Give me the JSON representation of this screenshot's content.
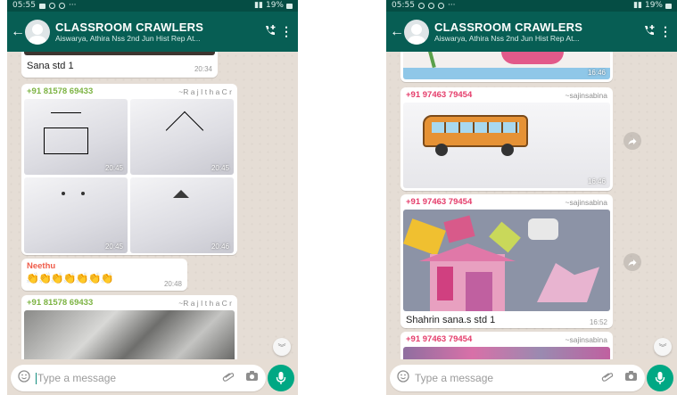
{
  "left": {
    "status": {
      "time": "05:55",
      "dots": "···",
      "battery": "19%"
    },
    "header": {
      "title": "CLASSROOM CRAWLERS",
      "subtitle": "Aiswarya, Athira Nss 2nd Jun Hist Rep At..."
    },
    "messages": {
      "top_text": "Sana std 1",
      "top_time": "20:34",
      "group1_sender": "+91 81578 69433",
      "group1_alias": "~R a j I t h a  C r",
      "img_times": [
        "20:45",
        "20:45",
        "20:45",
        "20:46"
      ],
      "neethu_sender": "Neethu",
      "claps": "👏👏👏👏👏👏👏",
      "claps_time": "20:48",
      "group2_sender": "+91 81578 69433",
      "group2_alias": "~R a j I t h a  C r"
    },
    "composer": {
      "placeholder": "Type a message"
    }
  },
  "right": {
    "status": {
      "time": "05:55",
      "dots": "···",
      "battery": "19%"
    },
    "header": {
      "title": "CLASSROOM CRAWLERS",
      "subtitle": "Aiswarya, Athira Nss 2nd Jun Hist Rep At..."
    },
    "messages": {
      "img1_time": "16:46",
      "msg1_sender": "+91 97463 79454",
      "msg1_alias": "~sajinsabina",
      "img2_time": "16:46",
      "msg2_sender": "+91 97463 79454",
      "msg2_alias": "~sajinsabina",
      "caption": "Shahrin sana.s std 1",
      "caption_time": "16:52",
      "msg3_sender": "+91 97463 79454",
      "msg3_alias": "~sajinsabina"
    },
    "composer": {
      "placeholder": "Type a message"
    }
  },
  "colors": {
    "header": "#075e54",
    "statusbar": "#054d44",
    "sender_green": "#7cb342",
    "sender_pink": "#e53d6b",
    "sender_neethu": "#ef5c4a",
    "mic": "#00a884"
  }
}
